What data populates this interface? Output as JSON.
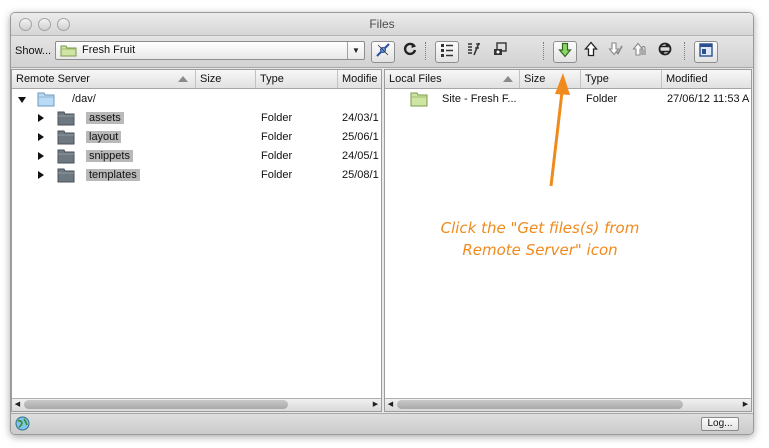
{
  "window": {
    "title": "Files"
  },
  "toolbar": {
    "show_label": "Show...",
    "site_value": "Fresh Fruit",
    "buttons": [
      {
        "icon": "connect-icon"
      },
      {
        "icon": "refresh-icon"
      },
      {
        "icon": "expand-view-icon"
      },
      {
        "icon": "sync-view-icon"
      },
      {
        "icon": "site-manage-icon"
      },
      {
        "icon": "get-files-icon"
      },
      {
        "icon": "put-files-icon"
      },
      {
        "icon": "check-out-icon"
      },
      {
        "icon": "check-in-icon"
      },
      {
        "icon": "synchronize-icon"
      },
      {
        "icon": "expand-collapse-icon"
      }
    ]
  },
  "remote": {
    "headers": {
      "name": "Remote Server",
      "size": "Size",
      "type": "Type",
      "modified": "Modifie"
    },
    "root": {
      "label": "/dav/"
    },
    "rows": [
      {
        "name": "assets",
        "type": "Folder",
        "modified": "24/03/1"
      },
      {
        "name": "layout",
        "type": "Folder",
        "modified": "25/06/1"
      },
      {
        "name": "snippets",
        "type": "Folder",
        "modified": "24/05/1"
      },
      {
        "name": "templates",
        "type": "Folder",
        "modified": "25/08/1"
      }
    ]
  },
  "local": {
    "headers": {
      "name": "Local Files",
      "size": "Size",
      "type": "Type",
      "modified": "Modified"
    },
    "rows": [
      {
        "name": "Site - Fresh F...",
        "type": "Folder",
        "modified": "27/06/12 11:53 A"
      }
    ]
  },
  "status": {
    "log_label": "Log..."
  },
  "annotation": {
    "line1": "Click the \"Get files(s) from",
    "line2": "Remote Server\" icon",
    "color": "#f08a1d"
  }
}
